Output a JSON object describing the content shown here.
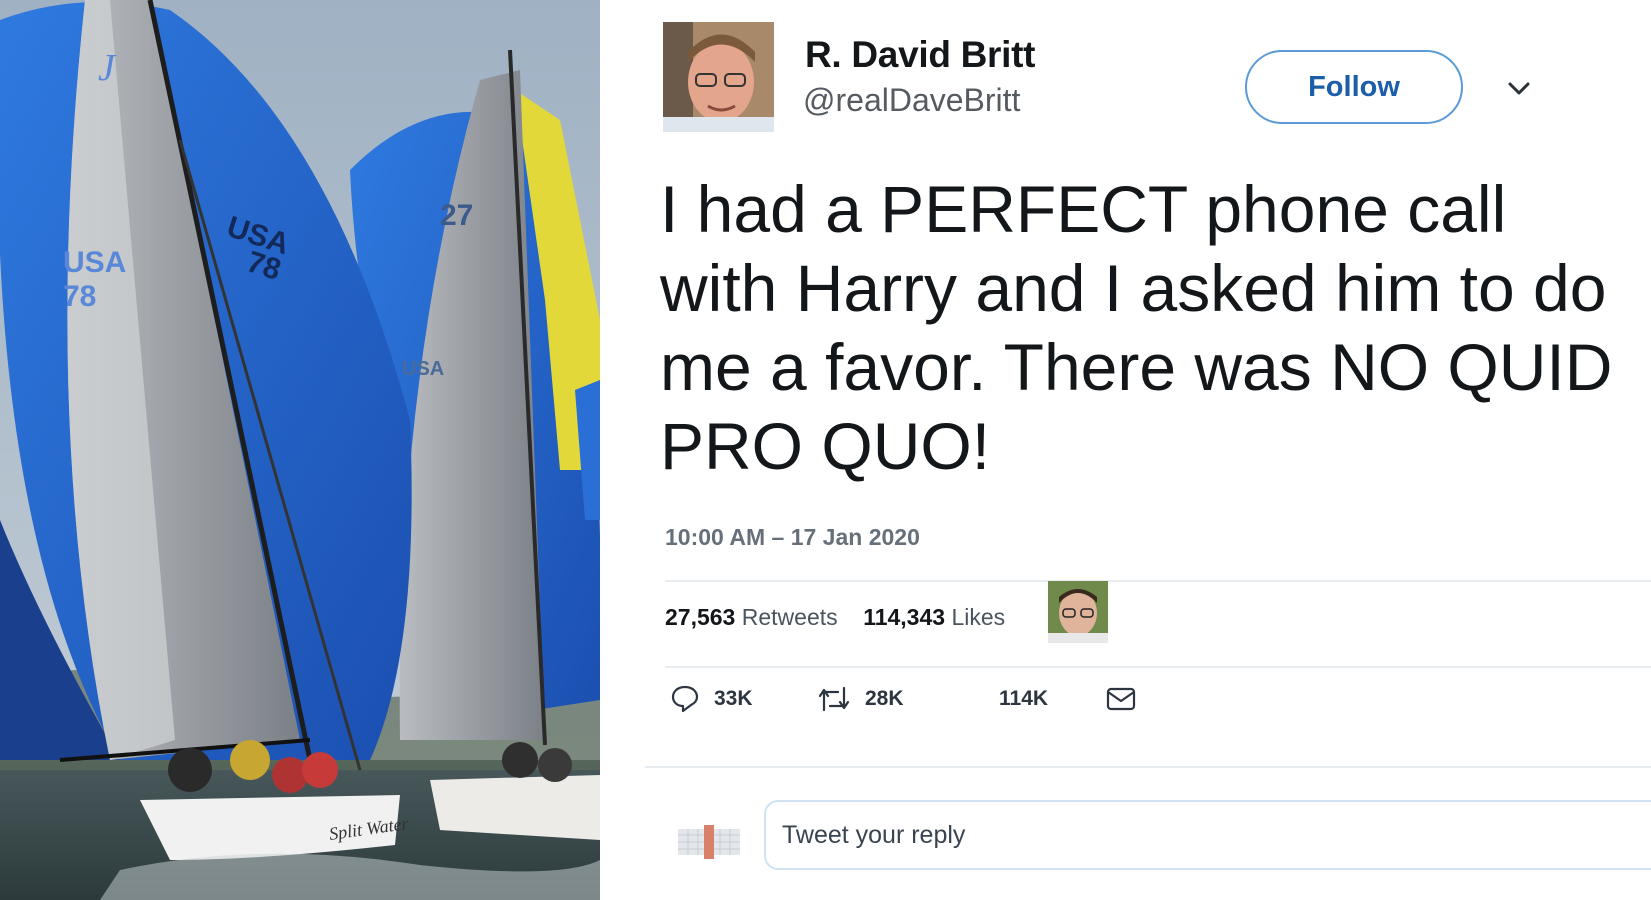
{
  "photo": {
    "sail_text_1": "USA",
    "sail_text_2": "78",
    "sail_text_3": "USA",
    "sail_text_4": "78",
    "sail_text_5": "27",
    "sail_text_6": "USA",
    "bow_text": "Split Water",
    "mast_logo": "J"
  },
  "tweet": {
    "display_name": "R. David Britt",
    "handle": "@realDaveBritt",
    "follow_label": "Follow",
    "text": "I had a PERFECT phone call with Harry and I asked him to do me a favor. There was NO QUID PRO QUO!",
    "timestamp": "10:00 AM – 17 Jan 2020",
    "retweets_count": "27,563",
    "retweets_label": "Retweets",
    "likes_count": "114,343",
    "likes_label": "Likes"
  },
  "actions": {
    "reply_count": "33K",
    "retweet_count": "28K",
    "like_count": "114K"
  },
  "reply": {
    "placeholder": "Tweet your reply"
  },
  "colors": {
    "follow_border": "#5a9bd6",
    "follow_text": "#1d5ea8",
    "divider": "#e6ecf0",
    "spinnaker_blue": "#2a6fd6"
  },
  "icons": [
    "chevron-down-icon",
    "reply-icon",
    "retweet-icon",
    "heart-icon",
    "mail-icon"
  ]
}
